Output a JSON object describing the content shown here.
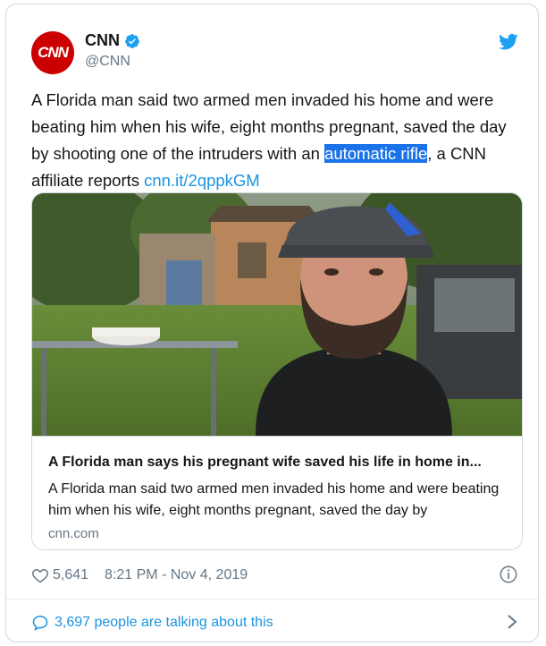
{
  "author": {
    "avatar_text": "CNN",
    "display_name": "CNN",
    "handle": "@CNN",
    "verified": true
  },
  "tweet": {
    "text_before": "A Florida man said two armed men invaded his home and were beating him when his wife, eight months pregnant, saved the day by shooting one of the intruders with an ",
    "highlighted": "automatic rifle",
    "text_after": ", a CNN affiliate reports ",
    "link": "cnn.it/2qppkGM"
  },
  "card": {
    "title": "A Florida man says his pregnant wife saved his life in home in...",
    "description": "A Florida man said two armed men invaded his home and were beating him when his wife, eight months pregnant, saved the day by",
    "domain": "cnn.com"
  },
  "stats": {
    "likes": "5,641",
    "timestamp": "8:21 PM - Nov 4, 2019"
  },
  "footer": {
    "talking_text": "3,697 people are talking about this"
  },
  "icons": {
    "brand": "twitter-bird-icon",
    "verified": "verified-badge-icon",
    "like": "heart-icon",
    "info": "info-icon",
    "reply": "speech-bubble-icon",
    "more": "chevron-right-icon"
  },
  "colors": {
    "link": "#1b95e0",
    "highlight": "#1a73e8",
    "avatar_bg": "#cc0000",
    "secondary_text": "#657786",
    "border": "#cfd9de"
  }
}
